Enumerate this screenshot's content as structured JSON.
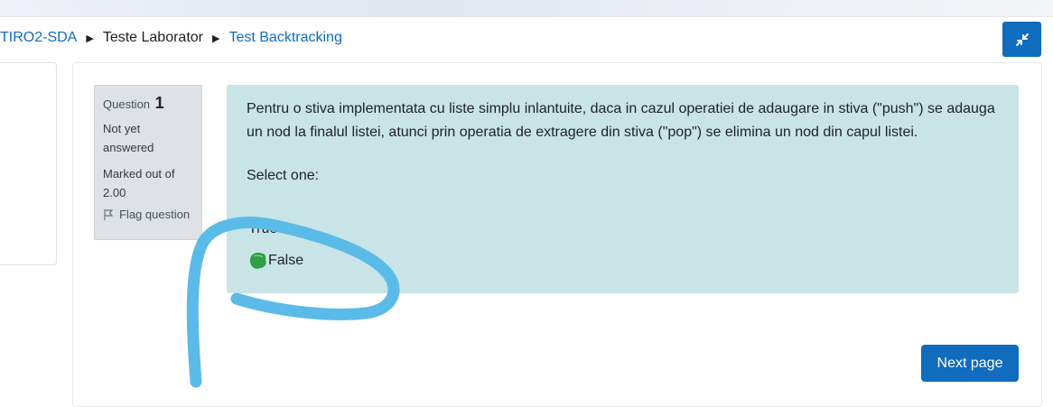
{
  "breadcrumb": {
    "items": [
      {
        "label": "TIRO2-SDA",
        "link": true
      },
      {
        "label": "Teste Laborator",
        "link": false
      },
      {
        "label": "Test Backtracking",
        "link": true
      }
    ]
  },
  "question_info": {
    "question_label": "Question",
    "question_number": "1",
    "state_line1": "Not yet",
    "state_line2": "answered",
    "grade_line1": "Marked out of",
    "grade_line2": "2.00",
    "flag_label": "Flag question"
  },
  "question": {
    "text": "Pentru o stiva implementata cu liste simplu inlantuite, daca in cazul operatiei de adaugare in stiva (\"push\") se adauga un nod la finalul listei, atunci prin operatia de extragere din stiva (\"pop\") se elimina un nod din capul listei.",
    "select_label": "Select one:",
    "options": [
      {
        "label": "True"
      },
      {
        "label": "False"
      }
    ]
  },
  "navigation": {
    "next_label": "Next page"
  },
  "colors": {
    "primary": "#0f6cbf",
    "question_bg": "#c9e4e6",
    "info_bg": "#dee2e6",
    "scribble": "#5bbbe8",
    "green_mark": "#2f9e44"
  }
}
